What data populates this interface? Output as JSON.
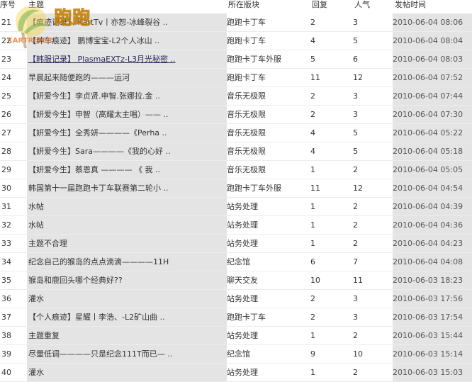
{
  "header": {
    "num": "序号",
    "title": "主题",
    "board": "所在版块",
    "reply": "回复",
    "popularity": "人气",
    "time": "发帖时间"
  },
  "logo": {
    "text": "跑跑",
    "sub": "KARTRIDER"
  },
  "rows": [
    {
      "num": "21",
      "title": "【痕迹记录】 KartTv丨亦恕-冰峰裂谷 ..",
      "board": "跑跑卡丁车",
      "reply": "2",
      "pop": "3",
      "time": "2010-06-04 08:06"
    },
    {
      "num": "22",
      "title": "【绅车痕迹】 鹏博宝宝-L2个人冰山 ..",
      "board": "跑跑卡丁车",
      "reply": "4",
      "pop": "5",
      "time": "2010-06-04 08:04"
    },
    {
      "num": "23",
      "title": "【韩服记录】 PlasmaEXTz-L3月光秘密 ..",
      "board": "跑跑卡丁车外服",
      "reply": "5",
      "pop": "6",
      "time": "2010-06-04 08:03"
    },
    {
      "num": "24",
      "title": "早晨起来随便跑的———运河",
      "board": "跑跑卡丁车",
      "reply": "11",
      "pop": "12",
      "time": "2010-06-04 07:52"
    },
    {
      "num": "25",
      "title": "【妍爱今生】李贞贤.申智.张娜拉.金 ..",
      "board": "音乐无极限",
      "reply": "2",
      "pop": "3",
      "time": "2010-06-04 07:44"
    },
    {
      "num": "26",
      "title": "【妍爱今生】申智（高耀太主唱）—— ..",
      "board": "音乐无极限",
      "reply": "2",
      "pop": "3",
      "time": "2010-06-04 07:30"
    },
    {
      "num": "27",
      "title": "【妍爱今生】全秀妍————《Perha ..",
      "board": "音乐无极限",
      "reply": "4",
      "pop": "5",
      "time": "2010-06-04 05:22"
    },
    {
      "num": "28",
      "title": "【妍爱今生】Sara————《我的心好 ..",
      "board": "音乐无极限",
      "reply": "4",
      "pop": "5",
      "time": "2010-06-04 05:18"
    },
    {
      "num": "29",
      "title": "【妍爱今生】蔡恩真 ———— 《 我 ..",
      "board": "音乐无极限",
      "reply": "1",
      "pop": "2",
      "time": "2010-06-04 05:05"
    },
    {
      "num": "30",
      "title": "韩国第十一届跑跑卡丁车联赛第二轮小 ..",
      "board": "跑跑卡丁车外服",
      "reply": "11",
      "pop": "12",
      "time": "2010-06-04 04:54"
    },
    {
      "num": "31",
      "title": "水帖",
      "board": "站务处理",
      "reply": "1",
      "pop": "2",
      "time": "2010-06-04 04:39"
    },
    {
      "num": "32",
      "title": "水帖",
      "board": "站务处理",
      "reply": "1",
      "pop": "2",
      "time": "2010-06-04 04:36"
    },
    {
      "num": "33",
      "title": "主题不合理",
      "board": "站务处理",
      "reply": "1",
      "pop": "2",
      "time": "2010-06-04 04:23"
    },
    {
      "num": "34",
      "title": "纪念自己的猴岛的点点滴滴————11H",
      "board": "纪念馆",
      "reply": "6",
      "pop": "7",
      "time": "2010-06-04 04:08"
    },
    {
      "num": "35",
      "title": "猴岛和鹿回头哪个经典好??",
      "board": "聊天交友",
      "reply": "10",
      "pop": "11",
      "time": "2010-06-03 18:23"
    },
    {
      "num": "36",
      "title": "灌水",
      "board": "站务处理",
      "reply": "2",
      "pop": "3",
      "time": "2010-06-03 17:56"
    },
    {
      "num": "37",
      "title": "【个人痕迹】星耀丨李浩、-L2矿山曲 ..",
      "board": "跑跑卡丁车",
      "reply": "2",
      "pop": "3",
      "time": "2010-06-03 17:54"
    },
    {
      "num": "38",
      "title": "主题重复",
      "board": "站务处理",
      "reply": "1",
      "pop": "2",
      "time": "2010-06-03 15:44"
    },
    {
      "num": "39",
      "title": "尽量低调————只是纪念111T而已— ..",
      "board": "纪念馆",
      "reply": "9",
      "pop": "10",
      "time": "2010-06-03 15:14"
    },
    {
      "num": "40",
      "title": "灌水",
      "board": "站务处理",
      "reply": "1",
      "pop": "2",
      "time": "2010-06-03 15:03"
    }
  ]
}
